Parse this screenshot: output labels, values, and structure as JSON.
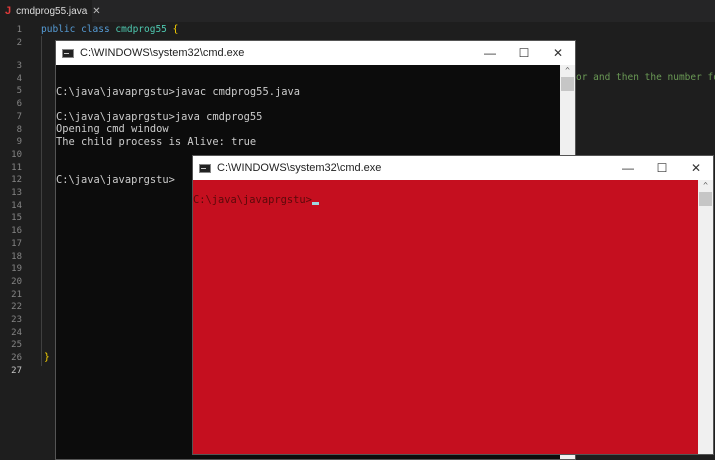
{
  "editor": {
    "tab_label": "cmdprog55.java",
    "tab_icon": "java-icon",
    "line_numbers": [
      "1",
      "2",
      "3",
      "4",
      "5",
      "6",
      "7",
      "8",
      "9",
      "10",
      "11",
      "12",
      "13",
      "14",
      "15",
      "16",
      "17",
      "18",
      "19",
      "20",
      "21",
      "22",
      "23",
      "24",
      "25",
      "26",
      "27"
    ],
    "code": {
      "kw1": "public",
      "kw2": "class",
      "classname": "cmdprog55",
      "open_brace": "{",
      "close_brace": "}",
      "comment_fragment": "or and then the number for"
    }
  },
  "cmd1": {
    "title": "C:\\WINDOWS\\system32\\cmd.exe",
    "lines": [
      "",
      "C:\\java\\javaprgstu>javac cmdprog55.java",
      "",
      "C:\\java\\javaprgstu>java cmdprog55",
      "Opening cmd window",
      "The child process is Alive: true",
      "",
      "",
      "C:\\java\\javaprgstu>"
    ],
    "bg": "#0c0c0c",
    "fg": "#cccccc"
  },
  "cmd2": {
    "title": "C:\\WINDOWS\\system32\\cmd.exe",
    "prompt": "C:\\java\\javaprgstu>",
    "bg": "#c50f1f",
    "fg": "#5a0a0a"
  },
  "controls": {
    "minimize": "—",
    "maximize": "☐",
    "close": "✕"
  }
}
